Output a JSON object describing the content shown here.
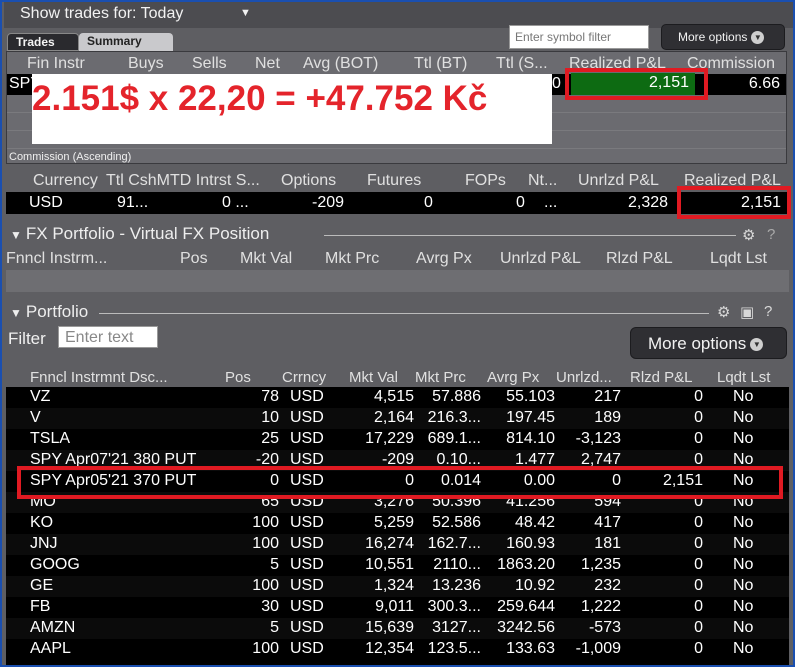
{
  "topbar": {
    "show_label": "Show trades for:  Today",
    "symbol_placeholder": "Enter symbol filter",
    "more_options": "More options"
  },
  "tabs": {
    "trades": "Trades",
    "summary": "Summary"
  },
  "trades_table": {
    "headers": [
      "Fin Instr",
      "Buys",
      "Sells",
      "Net",
      "Avg (BOT)",
      "Ttl (BT)",
      "Ttl (S...",
      "Realized P&L",
      "Commission"
    ],
    "row": {
      "instr": "SPY",
      "partial": "0",
      "realized": "2,151",
      "commission": "6.66"
    },
    "sort_label": "Commission (Ascending)"
  },
  "overlay_text": "2.151$ x 22,20 = +47.752 Kč",
  "account": {
    "headers": [
      "Currency",
      "Ttl CshMTD Intrst S...",
      "Options",
      "Futures",
      "FOPs",
      "Nt...",
      "Unrlzd P&L",
      "Realized P&L"
    ],
    "row": {
      "currency": "USD",
      "cash": "91...",
      "intrst": "0 ...",
      "options": "-209",
      "futures": "0",
      "fops": "0",
      "nt": "...",
      "unrlzd": "2,328",
      "realized": "2,151"
    }
  },
  "fx": {
    "title": "FX Portfolio - Virtual FX Position",
    "headers": [
      "Fnncl Instrm...",
      "Pos",
      "Mkt Val",
      "Mkt Prc",
      "Avrg Px",
      "Unrlzd P&L",
      "Rlzd P&L",
      "Lqdt Lst"
    ]
  },
  "portfolio": {
    "title": "Portfolio",
    "filter_label": "Filter",
    "filter_placeholder": "Enter text",
    "more_options": "More options",
    "headers": [
      "Fnncl Instrmnt Dsc...",
      "Pos",
      "Crrncy",
      "Mkt Val",
      "Mkt Prc",
      "Avrg Px",
      "Unrlzd...",
      "Rlzd P&L",
      "Lqdt Lst"
    ],
    "rows": [
      {
        "sym": "VZ",
        "pos": "78",
        "cur": "USD",
        "val": "4,515",
        "prc": "57.886",
        "avg": "55.103",
        "unr": "217",
        "rlz": "0",
        "lqd": "No"
      },
      {
        "sym": "V",
        "pos": "10",
        "cur": "USD",
        "val": "2,164",
        "prc": "216.3...",
        "avg": "197.45",
        "unr": "189",
        "rlz": "0",
        "lqd": "No"
      },
      {
        "sym": "TSLA",
        "pos": "25",
        "cur": "USD",
        "val": "17,229",
        "prc": "689.1...",
        "avg": "814.10",
        "unr": "-3,123",
        "rlz": "0",
        "lqd": "No"
      },
      {
        "sym": "SPY Apr07'21 380 PUT",
        "pos": "-20",
        "cur": "USD",
        "val": "-209",
        "prc": "0.10...",
        "avg": "1.477",
        "unr": "2,747",
        "rlz": "0",
        "lqd": "No"
      },
      {
        "sym": "SPY Apr05'21 370 PUT",
        "pos": "0",
        "cur": "USD",
        "val": "0",
        "prc": "0.014",
        "avg": "0.00",
        "unr": "0",
        "rlz": "2,151",
        "lqd": "No"
      },
      {
        "sym": "MO",
        "pos": "65",
        "cur": "USD",
        "val": "3,276",
        "prc": "50.396",
        "avg": "41.256",
        "unr": "594",
        "rlz": "0",
        "lqd": "No"
      },
      {
        "sym": "KO",
        "pos": "100",
        "cur": "USD",
        "val": "5,259",
        "prc": "52.586",
        "avg": "48.42",
        "unr": "417",
        "rlz": "0",
        "lqd": "No"
      },
      {
        "sym": "JNJ",
        "pos": "100",
        "cur": "USD",
        "val": "16,274",
        "prc": "162.7...",
        "avg": "160.93",
        "unr": "181",
        "rlz": "0",
        "lqd": "No"
      },
      {
        "sym": "GOOG",
        "pos": "5",
        "cur": "USD",
        "val": "10,551",
        "prc": "2110...",
        "avg": "1863.20",
        "unr": "1,235",
        "rlz": "0",
        "lqd": "No"
      },
      {
        "sym": "GE",
        "pos": "100",
        "cur": "USD",
        "val": "1,324",
        "prc": "13.236",
        "avg": "10.92",
        "unr": "232",
        "rlz": "0",
        "lqd": "No"
      },
      {
        "sym": "FB",
        "pos": "30",
        "cur": "USD",
        "val": "9,011",
        "prc": "300.3...",
        "avg": "259.644",
        "unr": "1,222",
        "rlz": "0",
        "lqd": "No"
      },
      {
        "sym": "AMZN",
        "pos": "5",
        "cur": "USD",
        "val": "15,639",
        "prc": "3127...",
        "avg": "3242.56",
        "unr": "-573",
        "rlz": "0",
        "lqd": "No"
      },
      {
        "sym": "AAPL",
        "pos": "100",
        "cur": "USD",
        "val": "12,354",
        "prc": "123.5...",
        "avg": "133.63",
        "unr": "-1,009",
        "rlz": "0",
        "lqd": "No"
      }
    ]
  },
  "colors": {
    "highlight_red": "#e01a22",
    "realized_green": "#0d6b12"
  }
}
